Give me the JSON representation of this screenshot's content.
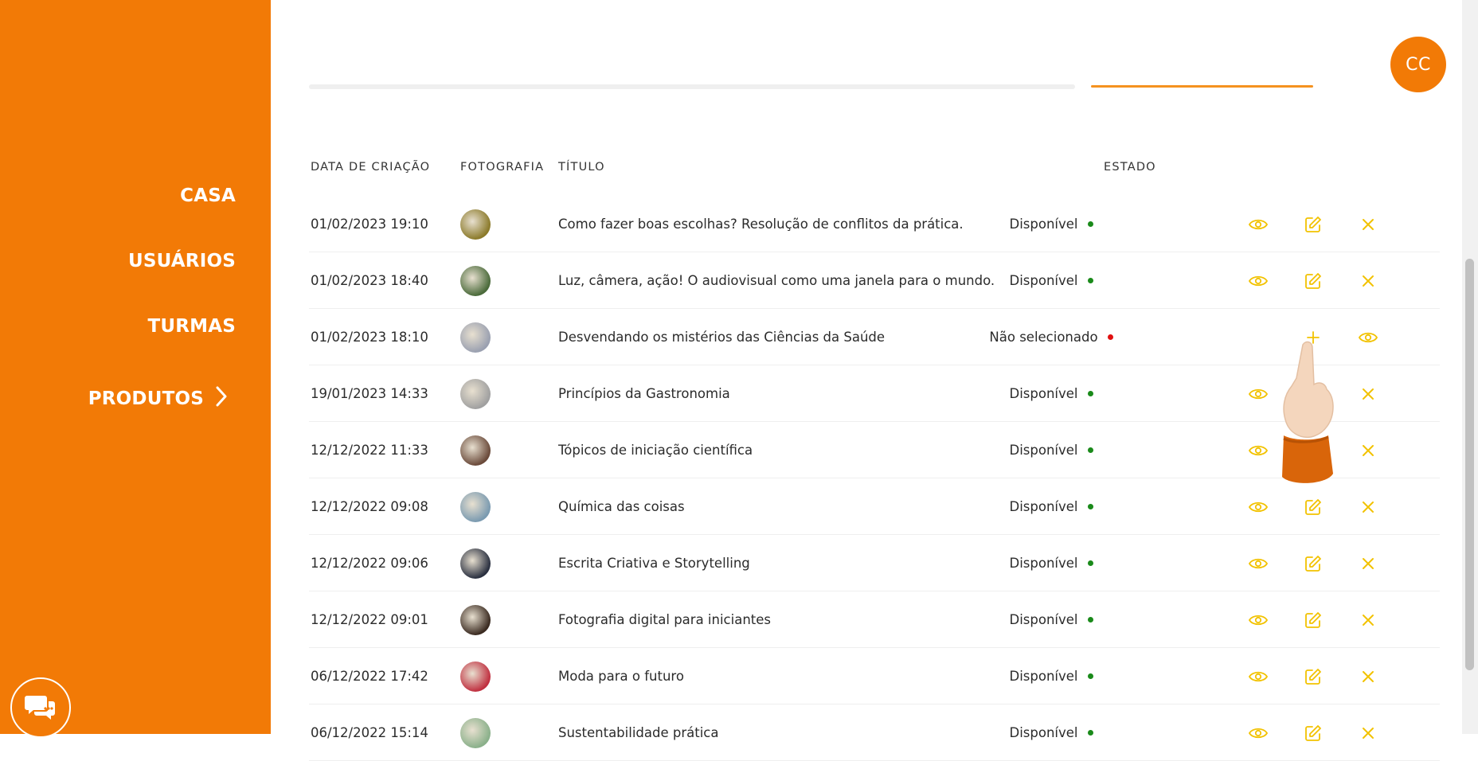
{
  "sidebar": {
    "items": [
      {
        "label": "CASA"
      },
      {
        "label": "USUÁRIOS"
      },
      {
        "label": "TURMAS"
      },
      {
        "label": "PRODUTOS",
        "active": true
      }
    ]
  },
  "header": {
    "avatar_initials": "CC"
  },
  "table": {
    "columns": [
      "DATA DE CRIAÇÃO",
      "FOTOGRAFIA",
      "TÍTULO",
      "ESTADO"
    ],
    "rows": [
      {
        "date": "01/02/2023 19:10",
        "title": "Como fazer boas escolhas? Resolução de conflitos da prática.",
        "status": "Disponível",
        "status_color": "#1a8a1a",
        "thumb_color": "#8b7a2a",
        "actions": [
          "eye",
          "edit",
          "close"
        ]
      },
      {
        "date": "01/02/2023 18:40",
        "title": "Luz, câmera, ação! O audiovisual como uma janela para o mundo.",
        "status": "Disponível",
        "status_color": "#1a8a1a",
        "thumb_color": "#4a6a3a",
        "actions": [
          "eye",
          "edit",
          "close"
        ]
      },
      {
        "date": "01/02/2023 18:10",
        "title": "Desvendando os mistérios das Ciências da Saúde",
        "status": "Não selecionado",
        "status_color": "#e01010",
        "thumb_color": "#9aa0b0",
        "actions": [
          "none",
          "plus",
          "eye"
        ]
      },
      {
        "date": "19/01/2023 14:33",
        "title": "Princípios da Gastronomia",
        "status": "Disponível",
        "status_color": "#1a8a1a",
        "thumb_color": "#a0a0a0",
        "actions": [
          "eye",
          "edit",
          "close"
        ]
      },
      {
        "date": "12/12/2022 11:33",
        "title": "Tópicos de iniciação científica",
        "status": "Disponível",
        "status_color": "#1a8a1a",
        "thumb_color": "#6a4a3a",
        "actions": [
          "eye",
          "edit",
          "close"
        ]
      },
      {
        "date": "12/12/2022 09:08",
        "title": "Química das coisas",
        "status": "Disponível",
        "status_color": "#1a8a1a",
        "thumb_color": "#7a9ab0",
        "actions": [
          "eye",
          "edit",
          "close"
        ]
      },
      {
        "date": "12/12/2022 09:06",
        "title": "Escrita Criativa e Storytelling",
        "status": "Disponível",
        "status_color": "#1a8a1a",
        "thumb_color": "#2a3040",
        "actions": [
          "eye",
          "edit",
          "close"
        ]
      },
      {
        "date": "12/12/2022 09:01",
        "title": "Fotografia digital para iniciantes",
        "status": "Disponível",
        "status_color": "#1a8a1a",
        "thumb_color": "#3a2a20",
        "actions": [
          "eye",
          "edit",
          "close"
        ]
      },
      {
        "date": "06/12/2022 17:42",
        "title": "Moda para o futuro",
        "status": "Disponível",
        "status_color": "#1a8a1a",
        "thumb_color": "#c03040",
        "actions": [
          "eye",
          "edit",
          "close"
        ]
      },
      {
        "date": "06/12/2022 15:14",
        "title": "Sustentabilidade prática",
        "status": "Disponível",
        "status_color": "#1a8a1a",
        "thumb_color": "#8ab08a",
        "actions": [
          "eye",
          "edit",
          "close"
        ]
      }
    ]
  },
  "colors": {
    "sidebar_bg": "#f27a06",
    "action_icon": "#f2c200",
    "status_available": "#1a8a1a",
    "status_unselected": "#e01010"
  }
}
